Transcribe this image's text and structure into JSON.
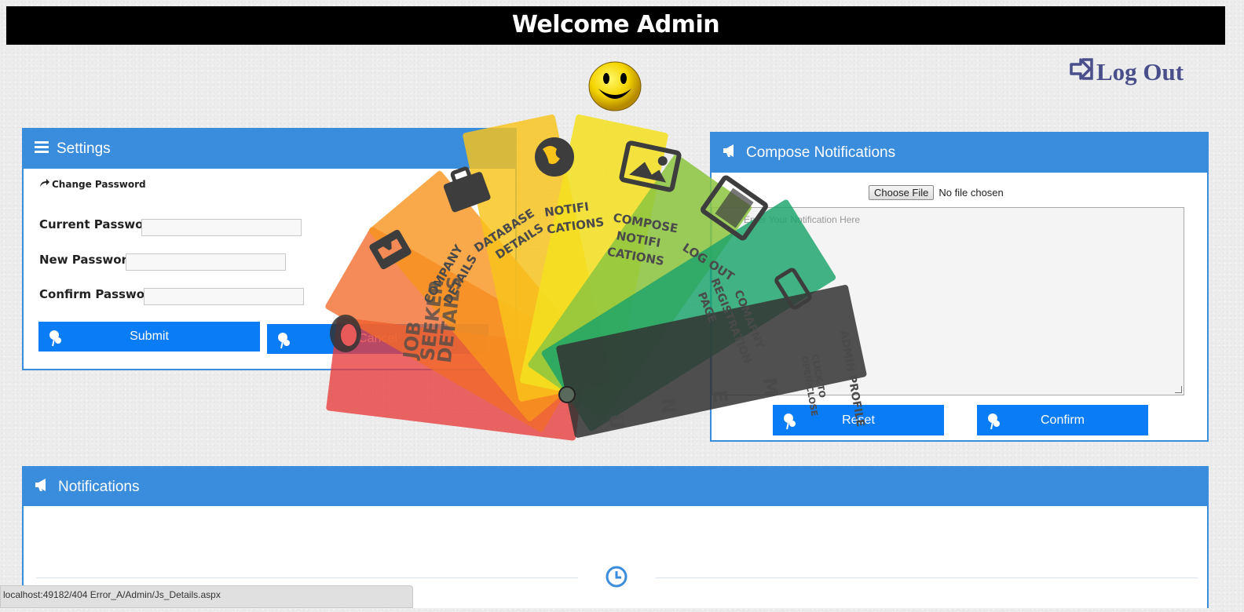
{
  "header": {
    "title": "Welcome Admin"
  },
  "logout": {
    "label": "Log Out"
  },
  "settings": {
    "title": "Settings",
    "change_password": "Change Password",
    "current_password_label": "Current Password:",
    "new_password_label": "New Password:",
    "confirm_password_label": "Confirm Password:",
    "submit_label": "Submit",
    "cancel_label": "Cancel"
  },
  "compose": {
    "title": "Compose Notifications",
    "choose_file_label": "Choose File",
    "no_file_text": "No file chosen",
    "textarea_placeholder": "Enter Your Notification Here",
    "reset_label": "Reset",
    "confirm_label": "Confirm"
  },
  "notifications": {
    "title": "Notifications"
  },
  "fan_menu": {
    "items": [
      {
        "label": "JOB SEEKER DETAILS",
        "icon": "eye-icon",
        "color": "#e83b3b"
      },
      {
        "label": "COMPANY DETAILS",
        "icon": "inbox-icon",
        "color": "#f26a2a"
      },
      {
        "label": "DATABASE DETAILS",
        "icon": "briefcase-icon",
        "color": "#f7941d"
      },
      {
        "label": "NOTIFI CATIONS",
        "icon": "globe-icon",
        "color": "#f9c31a"
      },
      {
        "label": "COMPOSE NOTIFI CATIONS",
        "icon": "image-icon",
        "color": "#f5e11e"
      },
      {
        "label": "LOG OUT",
        "icon": "film-icon",
        "color": "#8cc63f"
      },
      {
        "label": "COMAPNY REGISTRATION PAGE",
        "icon": "phone-icon",
        "color": "#1aa36a"
      },
      {
        "label": "ADMIN PROFILE",
        "icon": "user-icon",
        "color": "#333333"
      }
    ],
    "handle_text": "CLICK TO OPEN/CLOSE",
    "menu_letters": "M E N U"
  },
  "status_bar": {
    "url": "localhost:49182/404 Error_A/Admin/Js_Details.aspx"
  }
}
